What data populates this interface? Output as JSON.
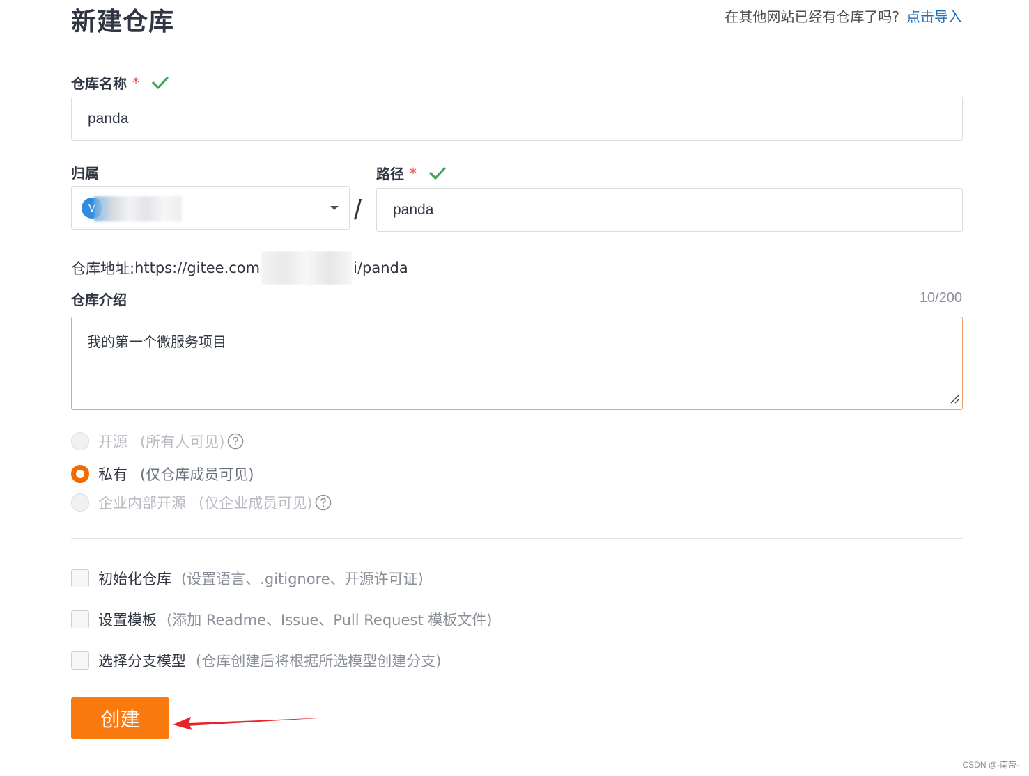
{
  "page": {
    "title": "新建仓库",
    "import_hint": "在其他网站已经有仓库了吗?",
    "import_link": "点击导入"
  },
  "repo_name": {
    "label": "仓库名称",
    "required_mark": "*",
    "value": "panda"
  },
  "owner": {
    "label": "归属",
    "avatar_initial": "V"
  },
  "path": {
    "label": "路径",
    "required_mark": "*",
    "separator": "/",
    "value": "panda"
  },
  "repo_url": {
    "label": "仓库地址:",
    "prefix": "https://gitee.com",
    "suffix": "i/panda"
  },
  "description": {
    "label": "仓库介绍",
    "counter": "10/200",
    "value": "我的第一个微服务项目"
  },
  "visibility": {
    "selected": "private",
    "options": [
      {
        "label": "开源",
        "hint": "(所有人可见)",
        "disabled": true,
        "help_icon": "question-circle-icon"
      },
      {
        "label": "私有",
        "hint": "(仅仓库成员可见)",
        "disabled": false
      },
      {
        "label": "企业内部开源",
        "hint": "(仅企业成员可见)",
        "disabled": true,
        "help_icon": "question-circle-icon"
      }
    ]
  },
  "options": {
    "init_repo": {
      "label": "初始化仓库",
      "hint": "(设置语言、.gitignore、开源许可证)",
      "checked": false
    },
    "template": {
      "label": "设置模板",
      "hint": "(添加 Readme、Issue、Pull Request 模板文件)",
      "checked": false
    },
    "branch_model": {
      "label": "选择分支模型",
      "hint": "(仓库创建后将根据所选模型创建分支)",
      "checked": false
    }
  },
  "create_button": {
    "label": "创建"
  },
  "watermark": "CSDN @-南帝-",
  "colors": {
    "accent": "#fb7a10",
    "link": "#1d6fb8",
    "valid_check": "#3aa65b",
    "required": "#e84a4a",
    "annotation_arrow": "#e8242b"
  }
}
